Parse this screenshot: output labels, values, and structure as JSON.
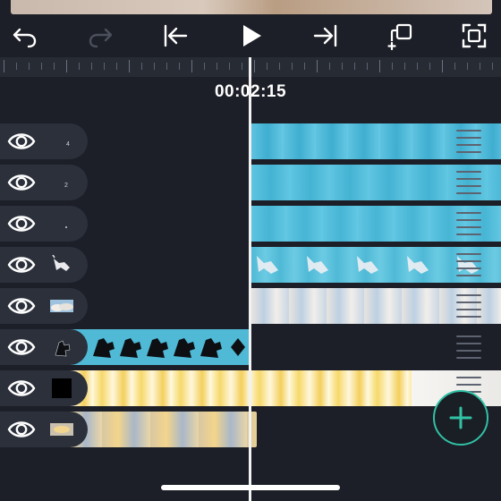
{
  "timecode": "00:02:15",
  "toolbar": {
    "buttons": [
      {
        "name": "undo-icon",
        "enabled": true
      },
      {
        "name": "redo-icon",
        "enabled": false
      },
      {
        "name": "skip-to-start-icon",
        "enabled": true
      },
      {
        "name": "play-icon",
        "enabled": true
      },
      {
        "name": "skip-to-end-icon",
        "enabled": true
      },
      {
        "name": "duplicate-layer-icon",
        "enabled": true
      },
      {
        "name": "fit-to-screen-icon",
        "enabled": true
      }
    ]
  },
  "tracks": [
    {
      "thumbnail": "number-4-icon",
      "clip": "sky-blue-strip"
    },
    {
      "thumbnail": "number-2-icon",
      "clip": "sky-blue-strip"
    },
    {
      "thumbnail": "dot-icon",
      "clip": "sky-blue-strip"
    },
    {
      "thumbnail": "unicorn-icon",
      "clip": "unicorn-sky-strip"
    },
    {
      "thumbnail": "clouds-icon",
      "clip": "clouds-strip"
    },
    {
      "thumbnail": "silhouette-icon",
      "clip": "silhouette-strip"
    },
    {
      "thumbnail": "black-frame-icon",
      "clip": "fire-strip"
    },
    {
      "thumbnail": "golden-clouds-icon",
      "clip": "golden-clouds-strip"
    }
  ],
  "add_button": "plus-icon",
  "colors": {
    "background": "#1c1f27",
    "accent": "#31c1a5",
    "clip_blue": "#4fb9d6",
    "playhead": "#f2f2f2"
  }
}
